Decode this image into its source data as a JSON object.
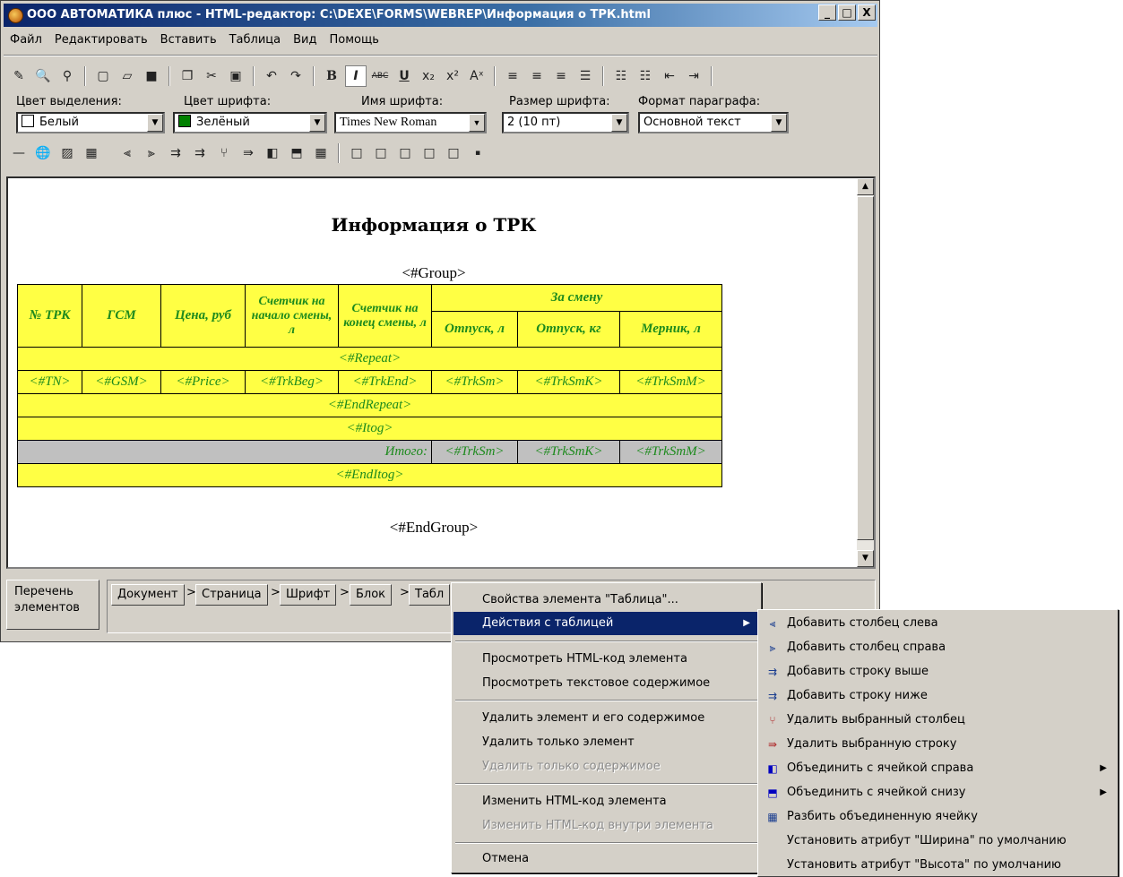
{
  "window": {
    "title": "ООО АВТОМАТИКА плюс - HTML-редактор: C:\\DEXE\\FORMS\\WEBREP\\Информация о ТРК.html",
    "minimize": "_",
    "maximize": "□",
    "close": "X"
  },
  "menu": [
    "Файл",
    "Редактировать",
    "Вставить",
    "Таблица",
    "Вид",
    "Помощь"
  ],
  "format": {
    "highlight_label": "Цвет выделения:",
    "highlight_value": "Белый",
    "highlight_color": "#ffffff",
    "font_color_label": "Цвет шрифта:",
    "font_color_value": "Зелёный",
    "font_color_swatch": "#008000",
    "font_name_label": "Имя шрифта:",
    "font_name_value": "Times New Roman",
    "font_size_label": "Размер шрифта:",
    "font_size_value": "2 (10 пт)",
    "paragraph_label": "Формат параграфа:",
    "paragraph_value": "Основной текст"
  },
  "toolbar_icons": [
    "magic-icon",
    "preview-icon",
    "find-icon",
    "new-icon",
    "open-icon",
    "save-icon",
    "copy-icon",
    "cut-icon",
    "paste-icon",
    "undo-icon",
    "redo-icon",
    "bold-icon",
    "italic-icon",
    "strike-icon",
    "underline-icon",
    "subscript-icon",
    "superscript-icon",
    "clear-format-icon",
    "align-left-icon",
    "align-center-icon",
    "align-right-icon",
    "justify-icon",
    "bullets-icon",
    "numbering-icon",
    "outdent-icon",
    "indent-icon"
  ],
  "document": {
    "title": "Информация о ТРК",
    "group_start": "<#Group>",
    "group_end": "<#EndGroup>",
    "header": {
      "c1": "№ ТРК",
      "c2": "ГСМ",
      "c3": "Цена, руб",
      "c4": "Счетчик на начало смены, л",
      "c5": "Счетчик на конец смены, л",
      "shift": "За смену",
      "s1": "Отпуск, л",
      "s2": "Отпуск, кг",
      "s3": "Мерник, л"
    },
    "repeat": "<#Repeat>",
    "row": [
      "<#TN>",
      "<#GSM>",
      "<#Price>",
      "<#TrkBeg>",
      "<#TrkEnd>",
      "<#TrkSm>",
      "<#TrkSmK>",
      "<#TrkSmM>"
    ],
    "end_repeat": "<#EndRepeat>",
    "itog": "<#Itog>",
    "total_label": "Итого:",
    "total": [
      "<#TrkSm>",
      "<#TrkSmK>",
      "<#TrkSmM>"
    ],
    "end_itog": "<#EndItog>"
  },
  "bottom": {
    "elements_button": "Перечень элементов",
    "crumbs": [
      "Документ",
      "Страница",
      "Шрифт",
      "Блок",
      "Табл"
    ]
  },
  "context_menu": {
    "items": [
      {
        "label": "Свойства элемента \"Таблица\"...",
        "enabled": true
      },
      {
        "label": "Действия с таблицей",
        "enabled": true,
        "highlighted": true,
        "submenu": true
      },
      {
        "label": "Просмотреть HTML-код элемента",
        "enabled": true
      },
      {
        "label": "Просмотреть текстовое содержимое",
        "enabled": true
      },
      {
        "label": "Удалить элемент и его содержимое",
        "enabled": true
      },
      {
        "label": "Удалить только элемент",
        "enabled": true
      },
      {
        "label": "Удалить только содержимое",
        "enabled": false
      },
      {
        "label": "Изменить HTML-код элемента",
        "enabled": true
      },
      {
        "label": "Изменить HTML-код внутри элемента",
        "enabled": false
      },
      {
        "label": "Отмена",
        "enabled": true
      }
    ]
  },
  "submenu": {
    "items": [
      {
        "label": "Добавить столбец слева",
        "icon": "insert-col-left-icon"
      },
      {
        "label": "Добавить столбец справа",
        "icon": "insert-col-right-icon"
      },
      {
        "label": "Добавить строку выше",
        "icon": "insert-row-above-icon"
      },
      {
        "label": "Добавить строку ниже",
        "icon": "insert-row-below-icon"
      },
      {
        "label": "Удалить выбранный столбец",
        "icon": "delete-col-icon"
      },
      {
        "label": "Удалить выбранную строку",
        "icon": "delete-row-icon"
      },
      {
        "label": "Объединить с ячейкой справа",
        "icon": "merge-right-icon",
        "submenu": true
      },
      {
        "label": "Объединить с ячейкой снизу",
        "icon": "merge-down-icon",
        "submenu": true
      },
      {
        "label": "Разбить объединенную ячейку",
        "icon": "split-cell-icon"
      },
      {
        "label": "Установить атрибут \"Ширина\" по умолчанию",
        "icon": ""
      },
      {
        "label": "Установить атрибут \"Высота\" по умолчанию",
        "icon": ""
      }
    ]
  }
}
